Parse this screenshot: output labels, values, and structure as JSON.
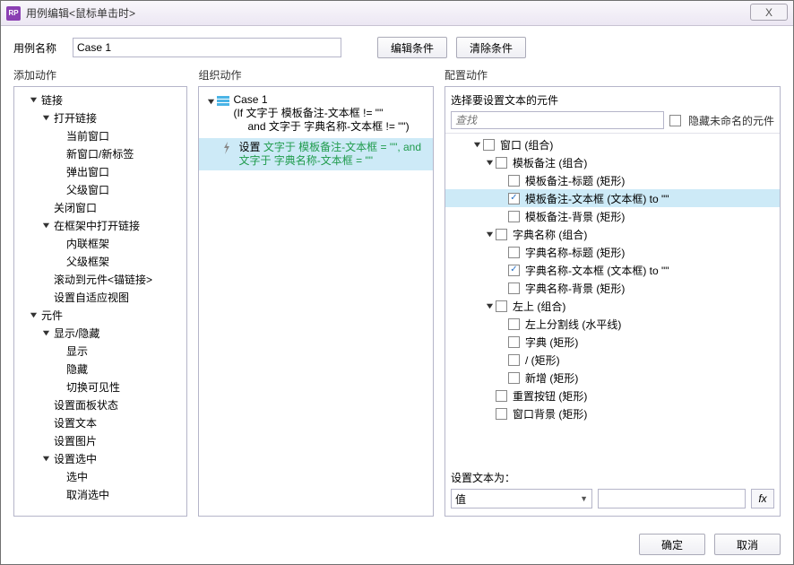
{
  "window": {
    "title": "用例编辑<鼠标单击时>",
    "logo_text": "RP",
    "close_glyph": "X"
  },
  "name_row": {
    "label": "用例名称",
    "value": "Case 1",
    "edit_cond_btn": "编辑条件",
    "clear_cond_btn": "清除条件"
  },
  "sections": {
    "add_label": "添加动作",
    "org_label": "组织动作",
    "cfg_label": "配置动作"
  },
  "add_tree": {
    "links": {
      "label": "链接",
      "open_link": "打开链接",
      "current_window": "当前窗口",
      "new_window": "新窗口/新标签",
      "popup": "弹出窗口",
      "parent_window": "父级窗口",
      "close_window": "关闭窗口",
      "open_in_frame": "在框架中打开链接",
      "inline_frame": "内联框架",
      "parent_frame": "父级框架",
      "scroll_anchor": "滚动到元件<锚链接>",
      "adaptive_view": "设置自适应视图"
    },
    "widgets": {
      "label": "元件",
      "show_hide": "显示/隐藏",
      "show": "显示",
      "hide": "隐藏",
      "toggle": "切换可见性",
      "panel_state": "设置面板状态",
      "set_text": "设置文本",
      "set_image": "设置图片",
      "set_selected": "设置选中",
      "selected": "选中",
      "unselected": "取消选中"
    }
  },
  "org": {
    "case_icon_col": "#4bb4e6",
    "case_line1": "Case 1",
    "case_line2": "(If 文字于 模板备注-文本框 != \"\"",
    "case_line3": "and 文字于 字典名称-文本框 != \"\")",
    "action_prefix": "设置 ",
    "action_green": "文字于 模板备注-文本框 = \"\", and 文字于 字典名称-文本框 = \"\""
  },
  "cfg": {
    "header": "选择要设置文本的元件",
    "search_placeholder": "查找",
    "hide_unnamed_label": "隐藏未命名的元件",
    "tree": {
      "window_group": "窗口 (组合)",
      "mb_group": "模板备注 (组合)",
      "mb_title": "模板备注-标题 (矩形)",
      "mb_text": "模板备注-文本框 (文本框) to \"\"",
      "mb_bg": "模板备注-背景 (矩形)",
      "dn_group": "字典名称 (组合)",
      "dn_title": "字典名称-标题 (矩形)",
      "dn_text": "字典名称-文本框 (文本框) to \"\"",
      "dn_bg": "字典名称-背景 (矩形)",
      "left_group": "左上 (组合)",
      "left_line": "左上分割线 (水平线)",
      "dict_rect": "字典 (矩形)",
      "slash_rect": "/ (矩形)",
      "add_rect": "新增 (矩形)",
      "reset_btn": "重置按钮 (矩形)",
      "window_bg": "窗口背景 (矩形)"
    },
    "set_text_label": "设置文本为：",
    "dropdown_value": "值",
    "text_value": "",
    "fx_label": "fx"
  },
  "footer": {
    "ok": "确定",
    "cancel": "取消"
  }
}
